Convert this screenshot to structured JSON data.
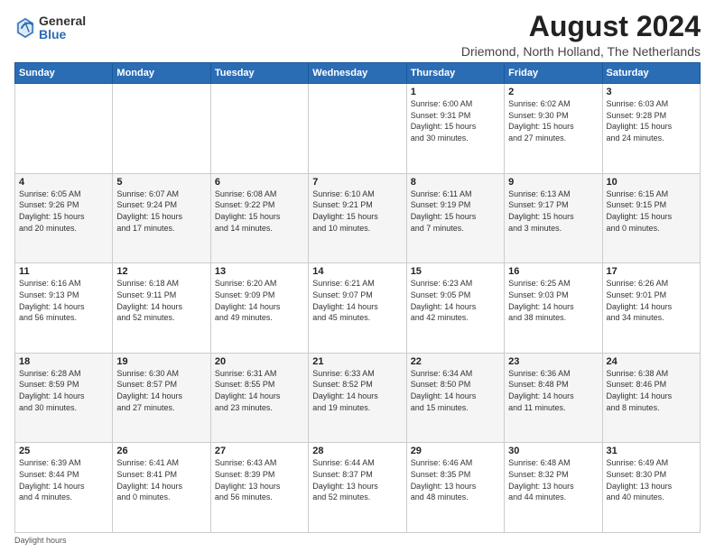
{
  "logo": {
    "general": "General",
    "blue": "Blue"
  },
  "title": "August 2024",
  "subtitle": "Driemond, North Holland, The Netherlands",
  "days_of_week": [
    "Sunday",
    "Monday",
    "Tuesday",
    "Wednesday",
    "Thursday",
    "Friday",
    "Saturday"
  ],
  "footer": "Daylight hours",
  "weeks": [
    [
      {
        "day": "",
        "info": ""
      },
      {
        "day": "",
        "info": ""
      },
      {
        "day": "",
        "info": ""
      },
      {
        "day": "",
        "info": ""
      },
      {
        "day": "1",
        "info": "Sunrise: 6:00 AM\nSunset: 9:31 PM\nDaylight: 15 hours\nand 30 minutes."
      },
      {
        "day": "2",
        "info": "Sunrise: 6:02 AM\nSunset: 9:30 PM\nDaylight: 15 hours\nand 27 minutes."
      },
      {
        "day": "3",
        "info": "Sunrise: 6:03 AM\nSunset: 9:28 PM\nDaylight: 15 hours\nand 24 minutes."
      }
    ],
    [
      {
        "day": "4",
        "info": "Sunrise: 6:05 AM\nSunset: 9:26 PM\nDaylight: 15 hours\nand 20 minutes."
      },
      {
        "day": "5",
        "info": "Sunrise: 6:07 AM\nSunset: 9:24 PM\nDaylight: 15 hours\nand 17 minutes."
      },
      {
        "day": "6",
        "info": "Sunrise: 6:08 AM\nSunset: 9:22 PM\nDaylight: 15 hours\nand 14 minutes."
      },
      {
        "day": "7",
        "info": "Sunrise: 6:10 AM\nSunset: 9:21 PM\nDaylight: 15 hours\nand 10 minutes."
      },
      {
        "day": "8",
        "info": "Sunrise: 6:11 AM\nSunset: 9:19 PM\nDaylight: 15 hours\nand 7 minutes."
      },
      {
        "day": "9",
        "info": "Sunrise: 6:13 AM\nSunset: 9:17 PM\nDaylight: 15 hours\nand 3 minutes."
      },
      {
        "day": "10",
        "info": "Sunrise: 6:15 AM\nSunset: 9:15 PM\nDaylight: 15 hours\nand 0 minutes."
      }
    ],
    [
      {
        "day": "11",
        "info": "Sunrise: 6:16 AM\nSunset: 9:13 PM\nDaylight: 14 hours\nand 56 minutes."
      },
      {
        "day": "12",
        "info": "Sunrise: 6:18 AM\nSunset: 9:11 PM\nDaylight: 14 hours\nand 52 minutes."
      },
      {
        "day": "13",
        "info": "Sunrise: 6:20 AM\nSunset: 9:09 PM\nDaylight: 14 hours\nand 49 minutes."
      },
      {
        "day": "14",
        "info": "Sunrise: 6:21 AM\nSunset: 9:07 PM\nDaylight: 14 hours\nand 45 minutes."
      },
      {
        "day": "15",
        "info": "Sunrise: 6:23 AM\nSunset: 9:05 PM\nDaylight: 14 hours\nand 42 minutes."
      },
      {
        "day": "16",
        "info": "Sunrise: 6:25 AM\nSunset: 9:03 PM\nDaylight: 14 hours\nand 38 minutes."
      },
      {
        "day": "17",
        "info": "Sunrise: 6:26 AM\nSunset: 9:01 PM\nDaylight: 14 hours\nand 34 minutes."
      }
    ],
    [
      {
        "day": "18",
        "info": "Sunrise: 6:28 AM\nSunset: 8:59 PM\nDaylight: 14 hours\nand 30 minutes."
      },
      {
        "day": "19",
        "info": "Sunrise: 6:30 AM\nSunset: 8:57 PM\nDaylight: 14 hours\nand 27 minutes."
      },
      {
        "day": "20",
        "info": "Sunrise: 6:31 AM\nSunset: 8:55 PM\nDaylight: 14 hours\nand 23 minutes."
      },
      {
        "day": "21",
        "info": "Sunrise: 6:33 AM\nSunset: 8:52 PM\nDaylight: 14 hours\nand 19 minutes."
      },
      {
        "day": "22",
        "info": "Sunrise: 6:34 AM\nSunset: 8:50 PM\nDaylight: 14 hours\nand 15 minutes."
      },
      {
        "day": "23",
        "info": "Sunrise: 6:36 AM\nSunset: 8:48 PM\nDaylight: 14 hours\nand 11 minutes."
      },
      {
        "day": "24",
        "info": "Sunrise: 6:38 AM\nSunset: 8:46 PM\nDaylight: 14 hours\nand 8 minutes."
      }
    ],
    [
      {
        "day": "25",
        "info": "Sunrise: 6:39 AM\nSunset: 8:44 PM\nDaylight: 14 hours\nand 4 minutes."
      },
      {
        "day": "26",
        "info": "Sunrise: 6:41 AM\nSunset: 8:41 PM\nDaylight: 14 hours\nand 0 minutes."
      },
      {
        "day": "27",
        "info": "Sunrise: 6:43 AM\nSunset: 8:39 PM\nDaylight: 13 hours\nand 56 minutes."
      },
      {
        "day": "28",
        "info": "Sunrise: 6:44 AM\nSunset: 8:37 PM\nDaylight: 13 hours\nand 52 minutes."
      },
      {
        "day": "29",
        "info": "Sunrise: 6:46 AM\nSunset: 8:35 PM\nDaylight: 13 hours\nand 48 minutes."
      },
      {
        "day": "30",
        "info": "Sunrise: 6:48 AM\nSunset: 8:32 PM\nDaylight: 13 hours\nand 44 minutes."
      },
      {
        "day": "31",
        "info": "Sunrise: 6:49 AM\nSunset: 8:30 PM\nDaylight: 13 hours\nand 40 minutes."
      }
    ]
  ]
}
